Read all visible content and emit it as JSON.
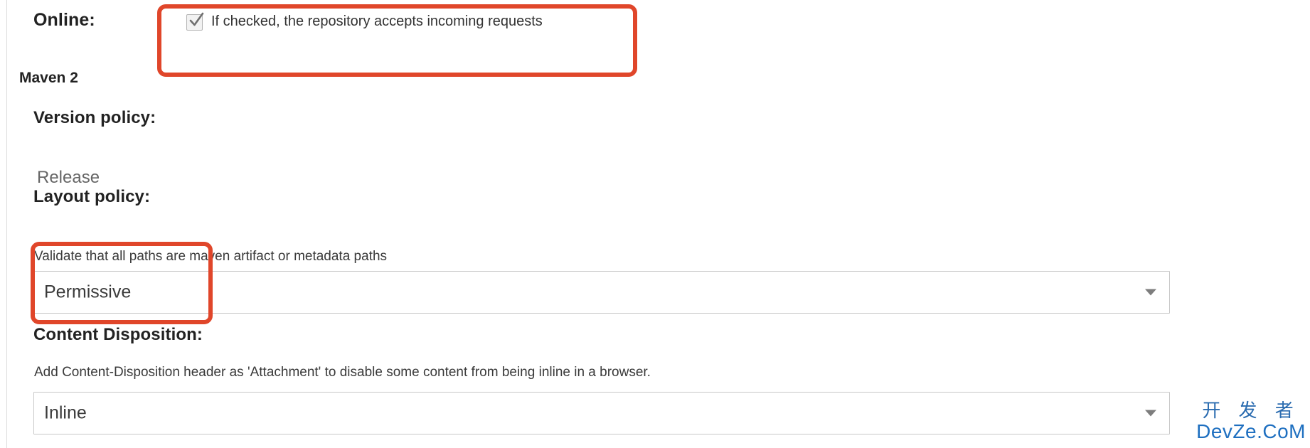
{
  "panel": {
    "online": {
      "label": "Online:",
      "checkbox_checked": true,
      "checkbox_text": "If checked, the repository accepts incoming requests"
    },
    "section_heading": "Maven 2",
    "version_policy": {
      "label": "Version policy:",
      "value": "Release"
    },
    "layout_policy": {
      "label": "Layout policy:",
      "description": "Validate that all paths are maven artifact or metadata paths",
      "selected": "Permissive"
    },
    "content_disposition": {
      "label": "Content Disposition:",
      "description": "Add Content-Disposition header as 'Attachment' to disable some content from being inline in a browser.",
      "selected": "Inline"
    }
  },
  "annotations": {
    "color": "#e0462a",
    "boxes": [
      {
        "name": "online-field-highlight"
      },
      {
        "name": "layout-policy-highlight"
      }
    ]
  },
  "watermark": {
    "chinese": "开 发 者",
    "latin": "DevZe.CoM",
    "color": "#1e6fc0"
  },
  "icons": {
    "check": "check-icon",
    "chevron_down": "chevron-down-icon"
  }
}
